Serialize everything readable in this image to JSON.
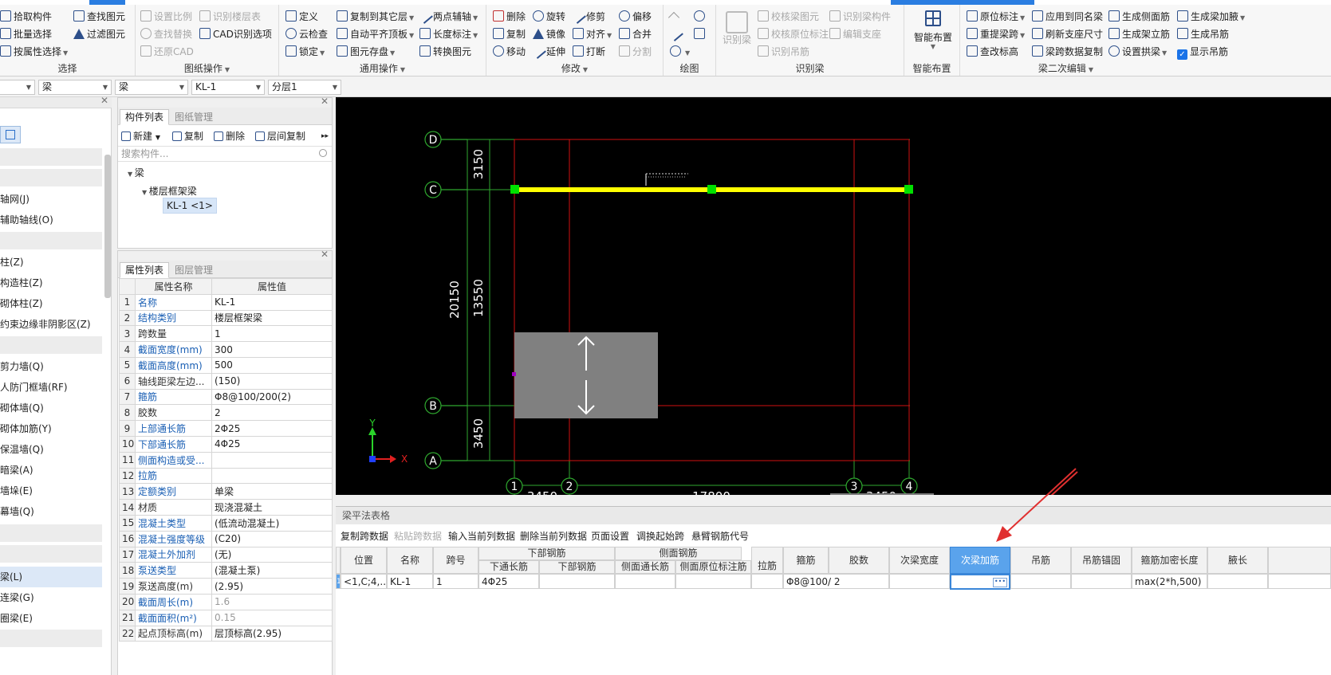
{
  "ribbon": {
    "groups": [
      {
        "label": "选择",
        "items": [
          "拾取构件",
          "批量选择",
          "按属性选择",
          "查找图元",
          "过滤图元"
        ]
      },
      {
        "label": "图纸操作",
        "items": [
          "设置比例",
          "识别楼层表",
          "查找替换",
          "CAD识别选项",
          "还原CAD"
        ]
      },
      {
        "label": "通用操作",
        "items": [
          "定义",
          "复制到其它层",
          "两点辅轴",
          "云检查",
          "自动平齐顶板",
          "长度标注",
          "锁定",
          "图元存盘",
          "转换图元"
        ]
      },
      {
        "label": "修改",
        "items": [
          "删除",
          "旋转",
          "修剪",
          "偏移",
          "复制",
          "镜像",
          "对齐",
          "合并",
          "移动",
          "延伸",
          "打断",
          "分割"
        ]
      },
      {
        "label": "绘图",
        "items": []
      },
      {
        "label": "识别梁",
        "items": [
          "识别梁",
          "校核梁图元",
          "识别梁构件",
          "校核原位标注",
          "编辑支座",
          "识别吊筋"
        ]
      },
      {
        "label": "智能布置",
        "items": [
          "智能布置"
        ]
      },
      {
        "label": "梁二次编辑",
        "items": [
          "原位标注",
          "应用到同名梁",
          "生成侧面筋",
          "生成梁加腋",
          "重提梁跨",
          "刷新支座尺寸",
          "生成架立筋",
          "生成吊筋",
          "查改标高",
          "梁跨数据复制",
          "设置拱梁",
          "显示吊筋"
        ]
      }
    ]
  },
  "dropdowns": [
    "",
    "梁",
    "梁",
    "KL-1",
    "分层1"
  ],
  "left_nav": {
    "items": [
      "轴网(J)",
      "辅助轴线(O)",
      "柱(Z)",
      "构造柱(Z)",
      "砌体柱(Z)",
      "约束边缘非阴影区(Z)",
      "剪力墙(Q)",
      "人防门框墙(RF)",
      "砌体墙(Q)",
      "砌体加筋(Y)",
      "保温墙(Q)",
      "暗梁(A)",
      "墙垛(E)",
      "幕墙(Q)",
      "梁(L)",
      "连梁(G)",
      "圈梁(E)"
    ]
  },
  "component_panel": {
    "tabs": [
      "构件列表",
      "图纸管理"
    ],
    "toolbar": [
      "新建",
      "复制",
      "删除",
      "层间复制"
    ],
    "search_placeholder": "搜索构件...",
    "tree": {
      "root": "梁",
      "child": "楼层框架梁",
      "leaf": "KL-1 <1>"
    }
  },
  "property_panel": {
    "tabs": [
      "属性列表",
      "图层管理"
    ],
    "headers": [
      "属性名称",
      "属性值"
    ],
    "rows": [
      {
        "n": "1",
        "name": "名称",
        "value": "KL-1"
      },
      {
        "n": "2",
        "name": "结构类别",
        "value": "楼层框架梁"
      },
      {
        "n": "3",
        "name": "跨数量",
        "value": "1"
      },
      {
        "n": "4",
        "name": "截面宽度(mm)",
        "value": "300"
      },
      {
        "n": "5",
        "name": "截面高度(mm)",
        "value": "500"
      },
      {
        "n": "6",
        "name": "轴线距梁左边...",
        "value": "(150)"
      },
      {
        "n": "7",
        "name": "箍筋",
        "value": "Φ8@100/200(2)"
      },
      {
        "n": "8",
        "name": "胶数",
        "value": "2"
      },
      {
        "n": "9",
        "name": "上部通长筋",
        "value": "2Φ25"
      },
      {
        "n": "10",
        "name": "下部通长筋",
        "value": "4Φ25"
      },
      {
        "n": "11",
        "name": "侧面构造或受...",
        "value": ""
      },
      {
        "n": "12",
        "name": "拉筋",
        "value": ""
      },
      {
        "n": "13",
        "name": "定额类别",
        "value": "单梁"
      },
      {
        "n": "14",
        "name": "材质",
        "value": "现浇混凝土"
      },
      {
        "n": "15",
        "name": "混凝土类型",
        "value": "(低流动混凝土)"
      },
      {
        "n": "16",
        "name": "混凝土强度等级",
        "value": "(C20)"
      },
      {
        "n": "17",
        "name": "混凝土外加剂",
        "value": "(无)"
      },
      {
        "n": "18",
        "name": "泵送类型",
        "value": "(混凝土泵)"
      },
      {
        "n": "19",
        "name": "泵送高度(m)",
        "value": "(2.95)"
      },
      {
        "n": "20",
        "name": "截面周长(m)",
        "value": "1.6"
      },
      {
        "n": "21",
        "name": "截面面积(m²)",
        "value": "0.15"
      },
      {
        "n": "22",
        "name": "起点顶标高(m)",
        "value": "层顶标高(2.95)"
      }
    ]
  },
  "canvas": {
    "axes_rows": [
      "D",
      "C",
      "B",
      "A"
    ],
    "axes_cols": [
      "1",
      "2",
      "3",
      "4"
    ],
    "dims_left": [
      "3150",
      "20150",
      "13550",
      "3450"
    ],
    "dims_bottom": [
      "3450",
      "17800",
      "3450"
    ],
    "ucs": {
      "x": "X",
      "y": "Y"
    }
  },
  "bottom_panel": {
    "title": "梁平法表格",
    "toolbar": [
      "复制跨数据",
      "粘贴跨数据",
      "输入当前列数据",
      "删除当前列数据",
      "页面设置",
      "调换起始跨",
      "悬臂钢筋代号"
    ],
    "headers": {
      "position": "位置",
      "name": "名称",
      "span": "跨号",
      "bottom_group": "下部钢筋",
      "bottom_cont": "下通长筋",
      "bottom_bar": "下部钢筋",
      "side_group": "侧面钢筋",
      "side_cont": "侧面通长筋",
      "side_orig": "侧面原位标注筋",
      "tie": "拉筋",
      "stirrup": "箍筋",
      "legs": "胶数",
      "sec_width": "次梁宽度",
      "sec_add": "次梁加筋",
      "hanger": "吊筋",
      "hanger_anchor": "吊筋锚固",
      "dense_len": "箍筋加密长度",
      "haunch": "腋长"
    },
    "row": {
      "n": "1",
      "position": "<1,C;4,...",
      "name": "KL-1",
      "span": "1",
      "bottom_cont": "4Φ25",
      "stirrup": "Φ8@100/ 2",
      "dense_len": "max(2*h,500)"
    }
  },
  "colors": {
    "accent": "#3a86d8",
    "beam": "#ffff00",
    "grip": "#00e000",
    "axis_line": "#d01010",
    "dim": "#2fa82f",
    "annotation_arrow": "#e03030"
  }
}
